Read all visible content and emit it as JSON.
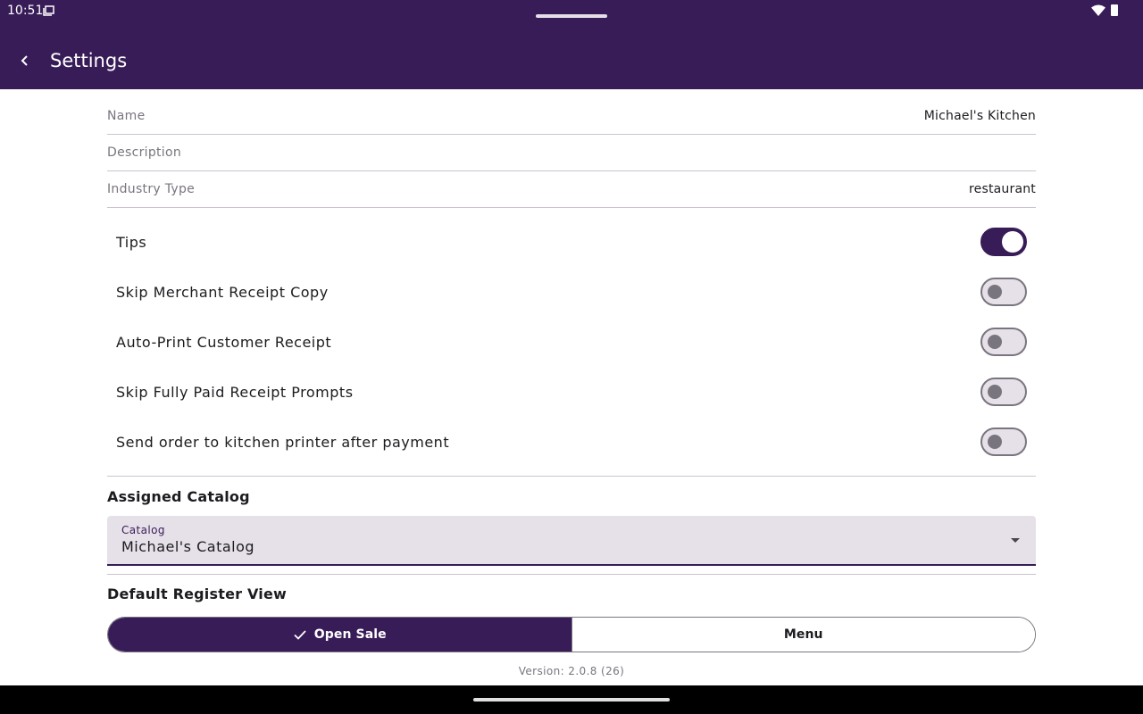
{
  "status_bar": {
    "time": "10:51",
    "icons": [
      "screen-icon",
      "wifi-icon",
      "battery-icon"
    ]
  },
  "app_bar": {
    "title": "Settings",
    "back_icon": "arrow-back-icon"
  },
  "info_rows": [
    {
      "label": "Name",
      "value": "Michael's Kitchen"
    },
    {
      "label": "Description",
      "value": ""
    },
    {
      "label": "Industry Type",
      "value": "restaurant"
    }
  ],
  "toggles": [
    {
      "label": "Tips",
      "on": true
    },
    {
      "label": "Skip Merchant Receipt Copy",
      "on": false
    },
    {
      "label": "Auto-Print Customer Receipt",
      "on": false
    },
    {
      "label": "Skip Fully Paid Receipt Prompts",
      "on": false
    },
    {
      "label": "Send order to kitchen printer after payment",
      "on": false
    }
  ],
  "assigned_catalog": {
    "title": "Assigned Catalog",
    "field_label": "Catalog",
    "selected": "Michael's Catalog"
  },
  "default_register_view": {
    "title": "Default Register View",
    "options": [
      {
        "label": "Open Sale",
        "selected": true
      },
      {
        "label": "Menu",
        "selected": false
      }
    ]
  },
  "version": "Version: 2.0.8 (26)",
  "colors": {
    "primary": "#381c57",
    "surface_variant": "#e6e0e9",
    "outline": "#79757f"
  }
}
